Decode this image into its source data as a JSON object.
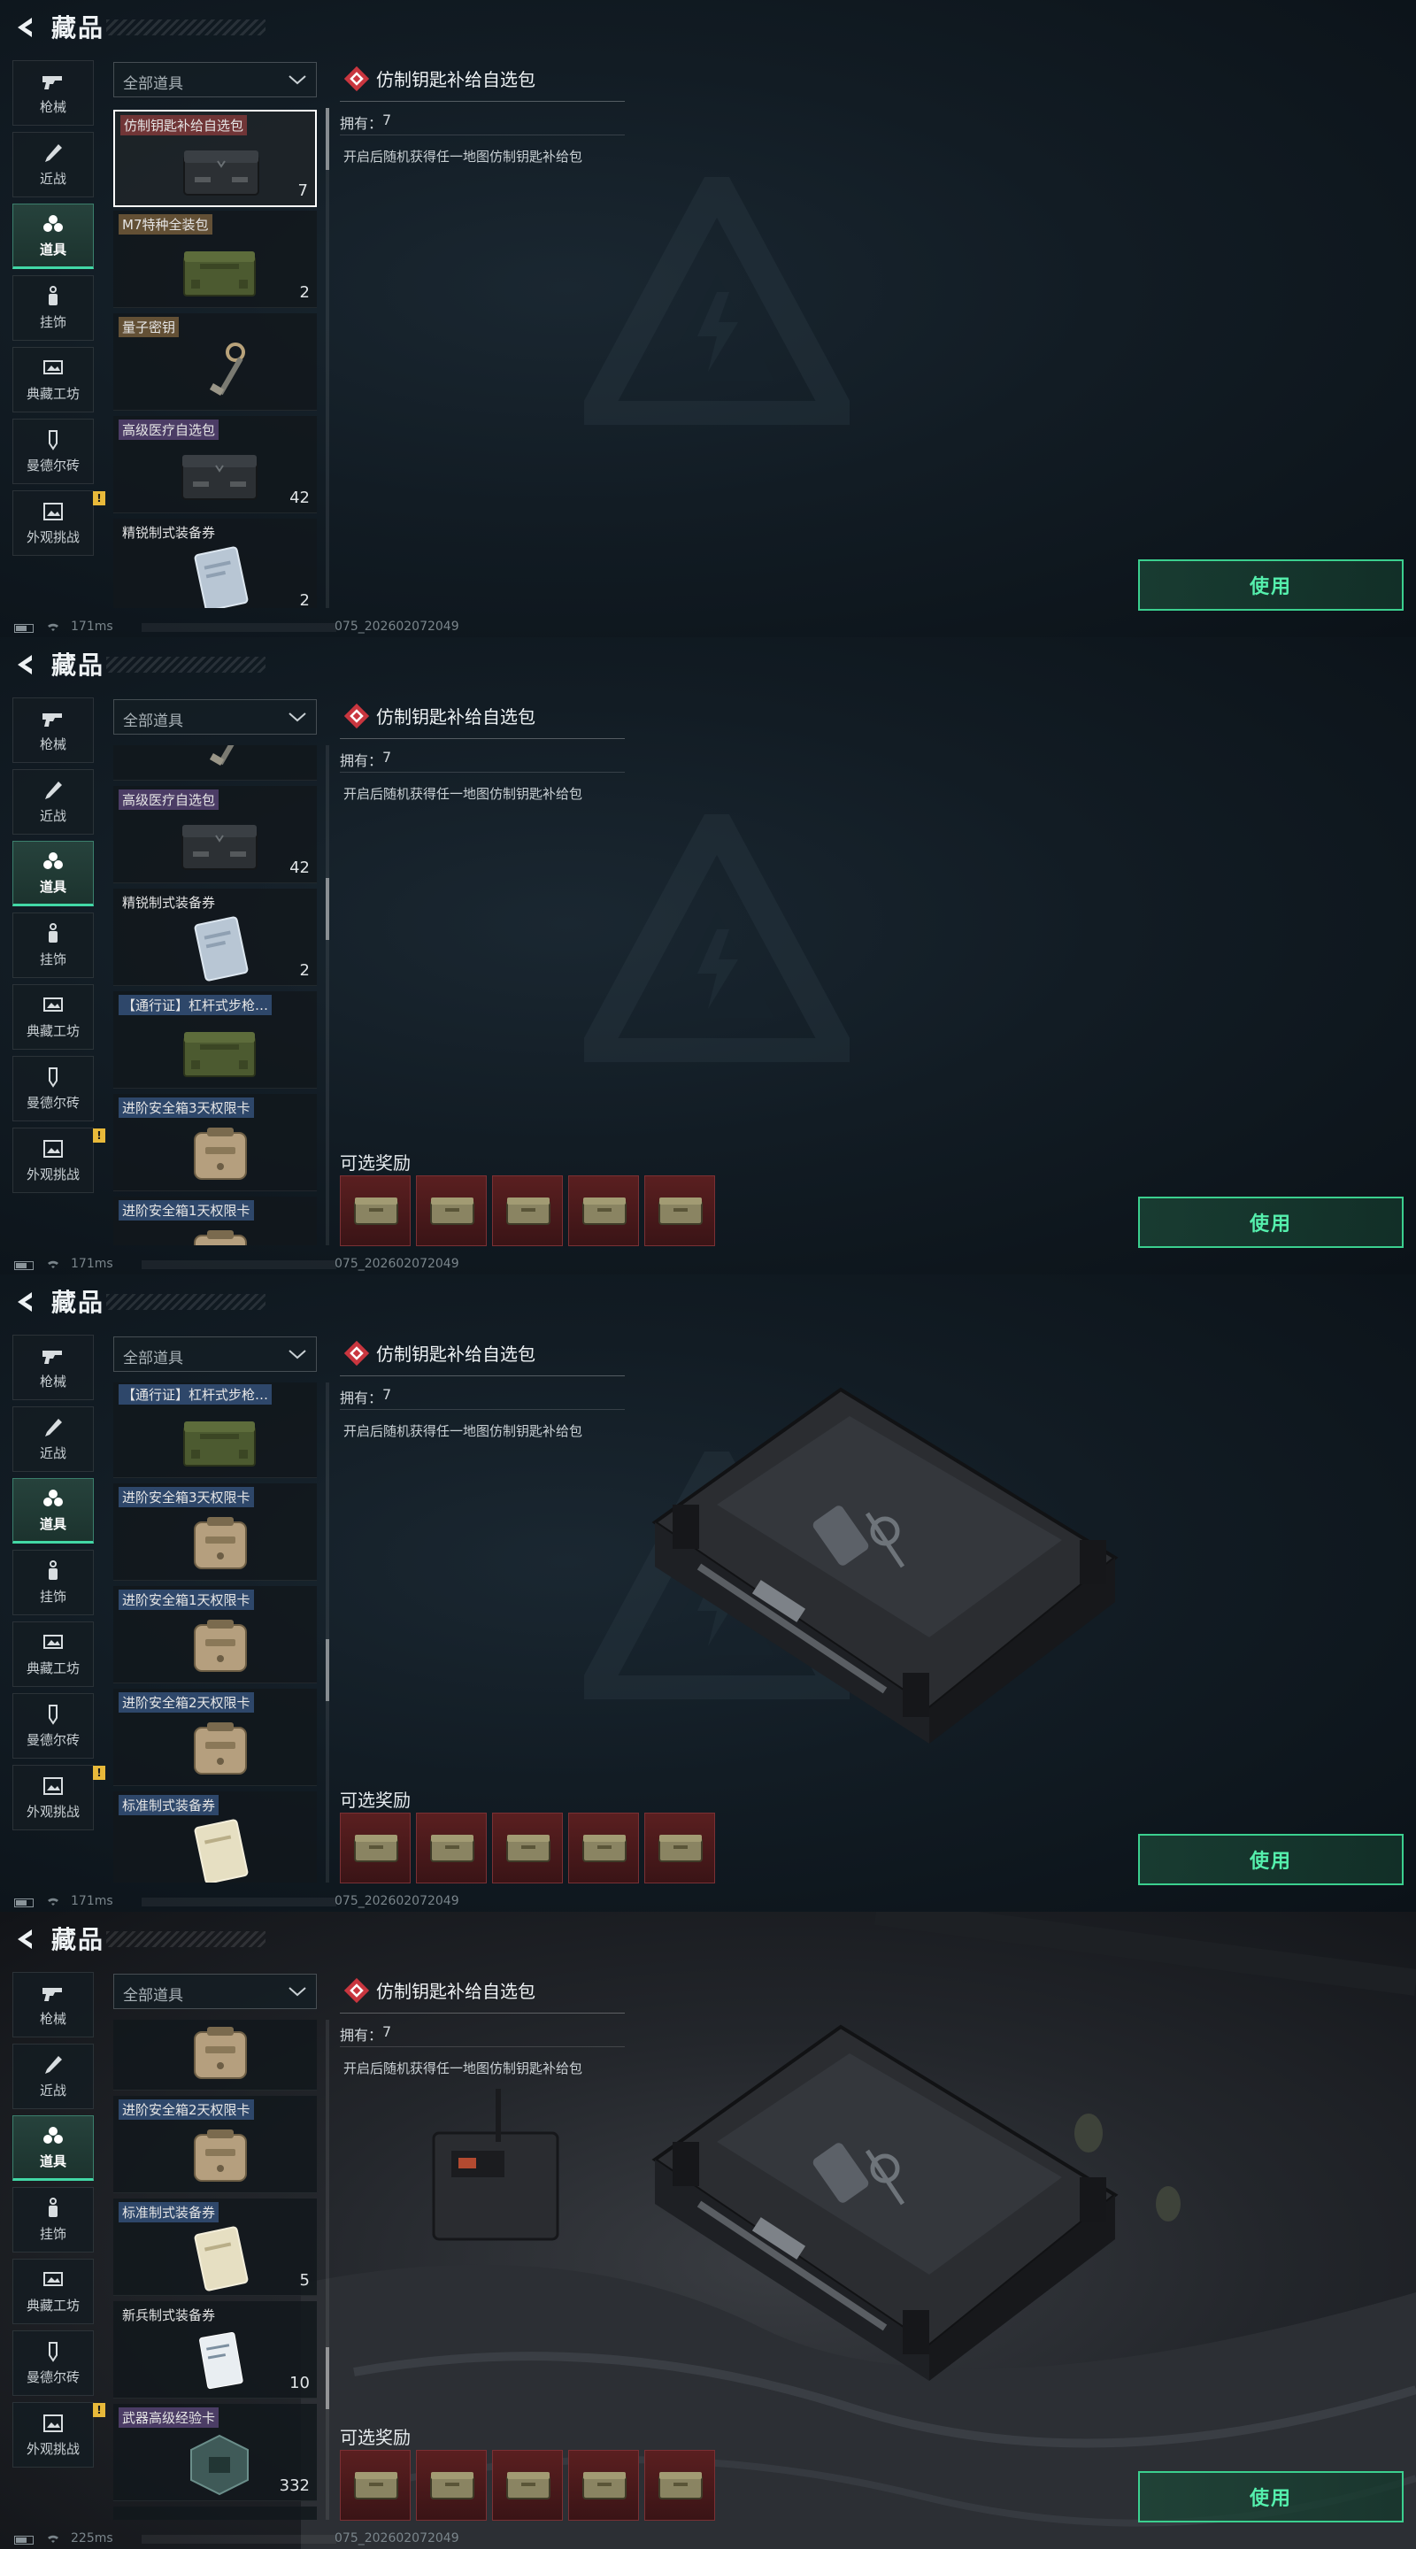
{
  "header": {
    "title": "藏品"
  },
  "nav": [
    {
      "label": "枪械",
      "icon": "gun-icon"
    },
    {
      "label": "近战",
      "icon": "knife-icon"
    },
    {
      "label": "道具",
      "icon": "items-icon"
    },
    {
      "label": "挂饰",
      "icon": "charm-icon"
    },
    {
      "label": "典藏工坊",
      "icon": "workshop-icon"
    },
    {
      "label": "曼德尔砖",
      "icon": "brick-icon"
    },
    {
      "label": "外观挑战",
      "icon": "appearance-icon"
    }
  ],
  "nav_badge": "!",
  "filter": {
    "label": "全部道具"
  },
  "items": {
    "i0": {
      "name": "仿制钥匙补给自选包",
      "count": "7"
    },
    "i1": {
      "name": "M7特种全装包",
      "count": "2"
    },
    "i2": {
      "name": "量子密钥",
      "count": ""
    },
    "i3": {
      "name": "高级医疗自选包",
      "count": "42"
    },
    "i4": {
      "name": "精锐制式装备券",
      "count": "2"
    },
    "i5": {
      "name": "【通行证】杠杆式步枪…",
      "count": ""
    },
    "i6": {
      "name": "进阶安全箱3天权限卡",
      "count": ""
    },
    "i7": {
      "name": "进阶安全箱1天权限卡",
      "count": ""
    },
    "i8": {
      "name": "进阶安全箱2天权限卡",
      "count": ""
    },
    "i9": {
      "name": "标准制式装备券",
      "count": "5"
    },
    "i10": {
      "name": "新兵制式装备券",
      "count": "10"
    },
    "i11": {
      "name": "武器高级经验卡",
      "count": "332"
    }
  },
  "detail": {
    "title": "仿制钥匙补给自选包",
    "own_label": "拥有：",
    "own_value": "7",
    "description": "开启后随机获得任一地图仿制钥匙补给包",
    "rewards_label": "可选奖励",
    "use_label": "使用"
  },
  "status": {
    "ping_a": "171ms",
    "ping_b": "225ms",
    "build": "075_202602072049"
  },
  "colors": {
    "accent": "#42d8a6",
    "use_button": "#3bd08f",
    "reward_bg": "#5a1f20",
    "diamond": "#e0474f"
  }
}
